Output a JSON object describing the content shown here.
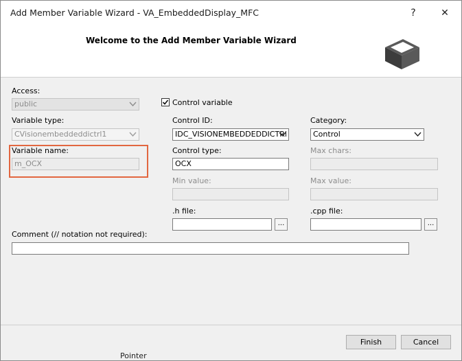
{
  "window": {
    "title": "Add Member Variable Wizard - VA_EmbeddedDisplay_MFC",
    "help_label": "?",
    "close_label": "✕"
  },
  "header": {
    "title": "Welcome to the Add Member Variable Wizard",
    "icon": "wizard-box-icon"
  },
  "form": {
    "access": {
      "label": "Access:",
      "value": "public"
    },
    "variable_type": {
      "label": "Variable type:",
      "value": "CVisionembeddeddictrl1"
    },
    "variable_name": {
      "label": "Variable name:",
      "value": "m_OCX"
    },
    "control_variable": {
      "label": "Control variable",
      "checked": true
    },
    "control_id": {
      "label": "Control ID:",
      "value": "IDC_VISIONEMBEDDEDDICTRl"
    },
    "category": {
      "label": "Category:",
      "value": "Control"
    },
    "control_type": {
      "label": "Control type:",
      "value": "OCX"
    },
    "max_chars": {
      "label": "Max chars:",
      "value": ""
    },
    "min_value": {
      "label": "Min value:",
      "value": ""
    },
    "max_value": {
      "label": "Max value:",
      "value": ""
    },
    "h_file": {
      "label": ".h file:",
      "value": "",
      "browse_label": "..."
    },
    "cpp_file": {
      "label": ".cpp file:",
      "value": "",
      "browse_label": "..."
    },
    "comment": {
      "label": "Comment (// notation not required):",
      "value": ""
    }
  },
  "buttons": {
    "finish": "Finish",
    "cancel": "Cancel"
  },
  "background_text": "Pointer",
  "colors": {
    "highlight_border": "#e2663f",
    "dialog_background": "#f0f0f0"
  }
}
